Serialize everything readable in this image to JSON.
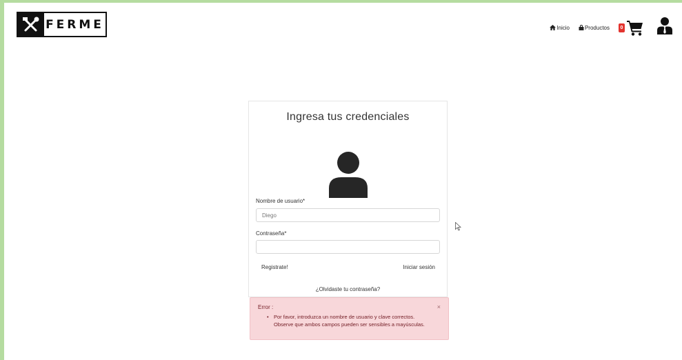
{
  "header": {
    "brand": "FERME",
    "nav": [
      {
        "label": "Inicio",
        "icon": "home-icon"
      },
      {
        "label": "Productos",
        "icon": "bag-icon"
      }
    ],
    "cart_count": "0"
  },
  "login": {
    "title": "Ingresa tus credenciales",
    "username_label": "Nombre de usuario*",
    "username_placeholder": "Diego",
    "password_label": "Contraseña*",
    "password_placeholder": "",
    "register_label": "Registrate!",
    "login_label": "Iniciar sesión",
    "forgot_label": "¿Olvidaste tu contraseña?"
  },
  "alert": {
    "title": "Error :",
    "close": "×",
    "messages": [
      "Por favor, introduzca un nombre de usuario y clave correctos.",
      "Observe que ambos campos pueden ser sensibles a mayúsculas."
    ]
  },
  "colors": {
    "frame": "#b5dca0",
    "alert_bg": "#f8d7da",
    "alert_text": "#721c24",
    "badge": "#e3342f"
  }
}
